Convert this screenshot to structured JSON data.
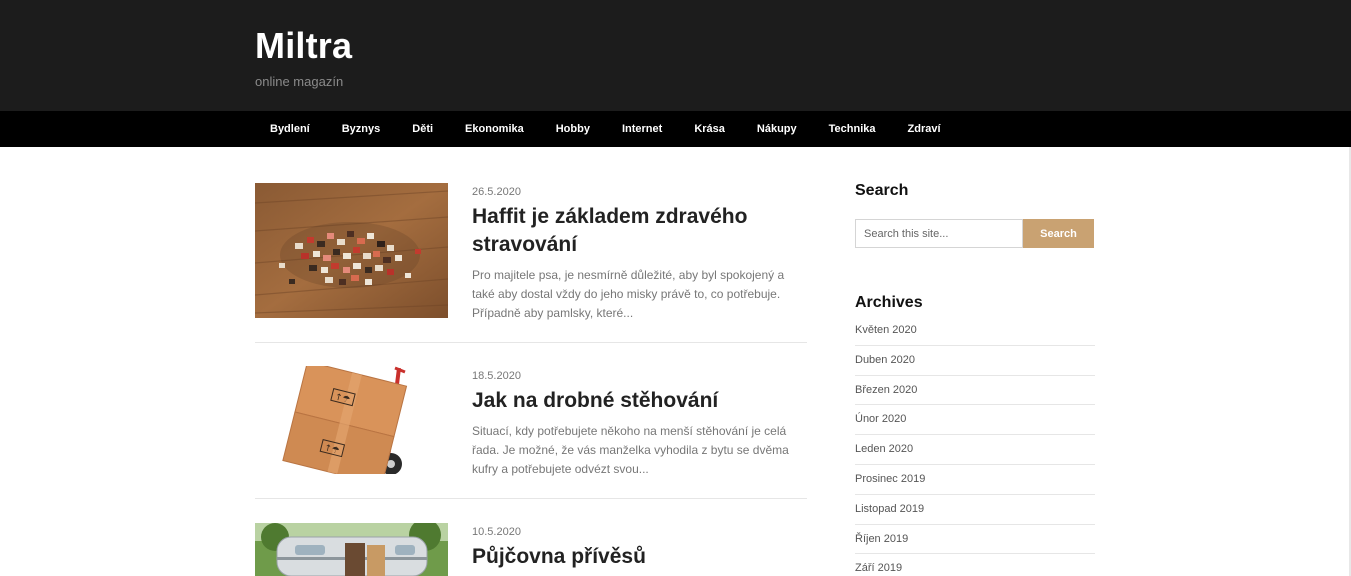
{
  "site": {
    "title": "Miltra",
    "description": "online magazín"
  },
  "nav": {
    "items": [
      "Bydlení",
      "Byznys",
      "Děti",
      "Ekonomika",
      "Hobby",
      "Internet",
      "Krása",
      "Nákupy",
      "Technika",
      "Zdraví"
    ]
  },
  "posts": [
    {
      "date": "26.5.2020",
      "title": "Haffit je základem zdravého stravování",
      "excerpt": "Pro majitele psa, je nesmírně důležité, aby byl spokojený a také aby dostal vždy do jeho misky právě to, co potřebuje. Případně aby pamlsky, které..."
    },
    {
      "date": "18.5.2020",
      "title": "Jak na drobné stěhování",
      "excerpt": "Situací, kdy potřebujete někoho na menší stěhování je celá řada. Je možné, že vás manželka vyhodila z bytu se dvěma kufry a potřebujete odvézt svou..."
    },
    {
      "date": "10.5.2020",
      "title": "Půjčovna přívěsů",
      "excerpt": ""
    }
  ],
  "sidebar": {
    "search": {
      "title": "Search",
      "placeholder": "Search this site...",
      "button_label": "Search"
    },
    "archives": {
      "title": "Archives",
      "items": [
        "Květen 2020",
        "Duben 2020",
        "Březen 2020",
        "Únor 2020",
        "Leden 2020",
        "Prosinec 2019",
        "Listopad 2019",
        "Říjen 2019",
        "Září 2019"
      ]
    }
  },
  "colors": {
    "header_bg": "#1c1c1c",
    "nav_bg": "#000000",
    "accent": "#c9a272"
  }
}
